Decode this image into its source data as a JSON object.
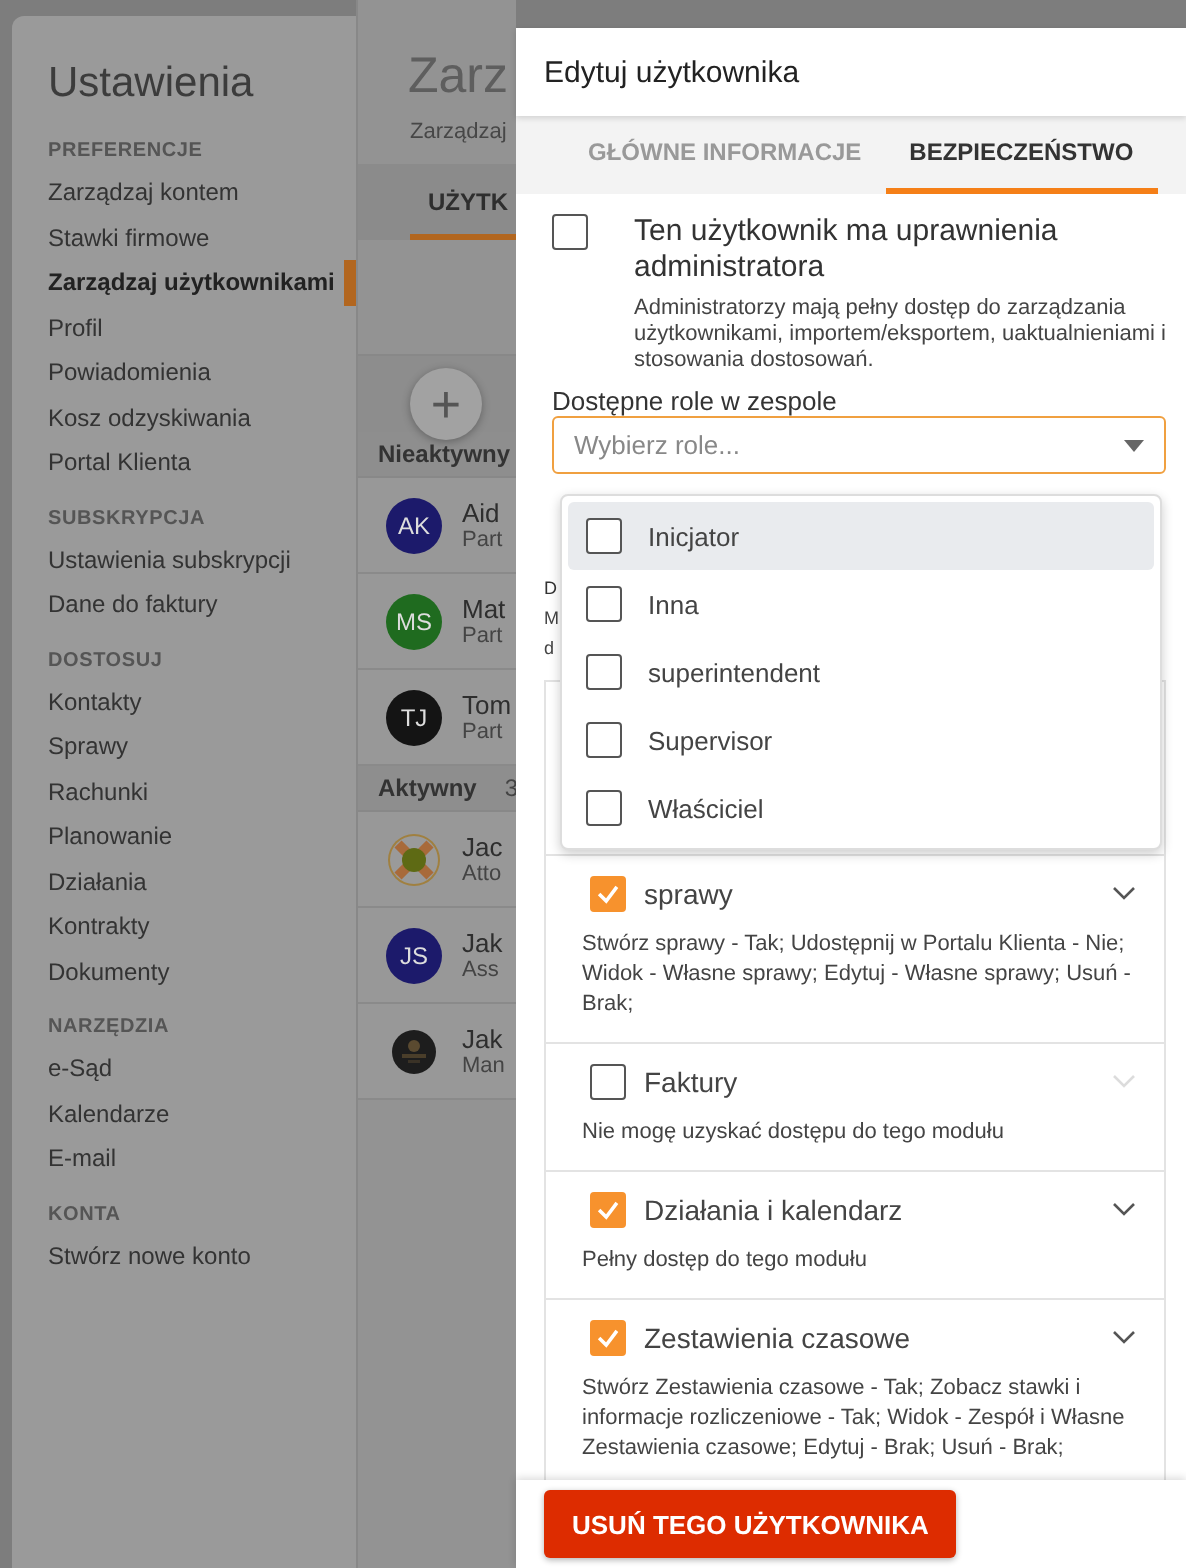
{
  "sidebar": {
    "title": "Ustawienia",
    "sections": [
      {
        "heading": "PREFERENCJE",
        "items": [
          {
            "label": "Zarządzaj kontem",
            "selected": false
          },
          {
            "label": "Stawki firmowe",
            "selected": false
          },
          {
            "label": "Zarządzaj użytkownikami",
            "selected": true
          },
          {
            "label": "Profil",
            "selected": false
          },
          {
            "label": "Powiadomienia",
            "selected": false
          },
          {
            "label": "Kosz odzyskiwania",
            "selected": false
          },
          {
            "label": "Portal Klienta",
            "selected": false
          }
        ]
      },
      {
        "heading": "SUBSKRYPCJA",
        "items": [
          {
            "label": "Ustawienia subskrypcji",
            "selected": false
          },
          {
            "label": "Dane do faktury",
            "selected": false
          }
        ]
      },
      {
        "heading": "DOSTOSUJ",
        "items": [
          {
            "label": "Kontakty",
            "selected": false
          },
          {
            "label": "Sprawy",
            "selected": false
          },
          {
            "label": "Rachunki",
            "selected": false
          },
          {
            "label": "Planowanie",
            "selected": false
          },
          {
            "label": "Działania",
            "selected": false
          },
          {
            "label": "Kontrakty",
            "selected": false
          },
          {
            "label": "Dokumenty",
            "selected": false
          }
        ]
      },
      {
        "heading": "NARZĘDZIA",
        "items": [
          {
            "label": "e-Sąd",
            "selected": false
          },
          {
            "label": "Kalendarze",
            "selected": false
          },
          {
            "label": "E-mail",
            "selected": false
          }
        ]
      },
      {
        "heading": "KONTA",
        "items": [
          {
            "label": "Stwórz nowe konto",
            "selected": false
          }
        ]
      }
    ]
  },
  "main": {
    "title": "Zarz",
    "subtitle": "Zarządzaj",
    "tabs": [
      {
        "label": "UŻYTK",
        "selected": true
      }
    ],
    "add_button": "+",
    "groups": [
      {
        "label": "Nieaktywny",
        "users": [
          {
            "name": "Aid",
            "role": "Part",
            "avatar": {
              "kind": "initials",
              "initials": "AK",
              "color": "#1c1a6b"
            }
          },
          {
            "name": "Mat",
            "role": "Part",
            "avatar": {
              "kind": "initials",
              "initials": "MS",
              "color": "#1f6b1f"
            }
          },
          {
            "name": "Tom",
            "role": "Part",
            "avatar": {
              "kind": "initials",
              "initials": "TJ",
              "color": "#141414"
            }
          }
        ]
      },
      {
        "label": "Aktywny",
        "count": "3",
        "users": [
          {
            "name": "Jac",
            "role": "Atto",
            "avatar": {
              "kind": "lifebuoy"
            }
          },
          {
            "name": "Jak",
            "role": "Ass",
            "avatar": {
              "kind": "initials",
              "initials": "JS",
              "color": "#1c1a6b"
            }
          },
          {
            "name": "Jak",
            "role": "Man"
          }
        ]
      }
    ]
  },
  "dialog": {
    "title": "Edytuj użytkownika",
    "tabs": [
      {
        "label": "GŁÓWNE INFORMACJE",
        "selected": false
      },
      {
        "label": "BEZPIECZEŃSTWO",
        "selected": true
      }
    ],
    "admin": {
      "checked": false,
      "label": "Ten użytkownik ma uprawnienia administratora",
      "description": "Administratorzy mają pełny dostęp do zarządzania użytkownikami, importem/eksportem, uaktualnieniami i stosowania dostosowań."
    },
    "roles": {
      "label": "Dostępne role w zespole",
      "placeholder": "Wybierz role...",
      "expanded": true,
      "options": [
        {
          "label": "Inicjator",
          "checked": false,
          "highlighted": true
        },
        {
          "label": "Inna",
          "checked": false,
          "highlighted": false
        },
        {
          "label": "superintendent",
          "checked": false,
          "highlighted": false
        },
        {
          "label": "Supervisor",
          "checked": false,
          "highlighted": false
        },
        {
          "label": "Właściciel",
          "checked": false,
          "highlighted": false
        }
      ]
    },
    "covered_section": {
      "title": "D",
      "lines": [
        "M",
        "d"
      ]
    },
    "modules": [
      {
        "name": "sprawy",
        "checked": true,
        "description": "Stwórz sprawy - Tak; Udostępnij w Portalu Klienta - Nie; Widok - Własne sprawy; Edytuj - Własne sprawy; Usuń - Brak;"
      },
      {
        "name": "Faktury",
        "checked": false,
        "description": "Nie mogę uzyskać dostępu do tego modułu"
      },
      {
        "name": "Działania i kalendarz",
        "checked": true,
        "description": "Pełny dostęp do tego modułu"
      },
      {
        "name": "Zestawienia czasowe",
        "checked": true,
        "description": "Stwórz Zestawienia czasowe - Tak; Zobacz stawki i informacje rozliczeniowe - Tak; Widok - Zespół i Własne Zestawienia czasowe; Edytuj - Brak; Usuń - Brak;"
      }
    ],
    "delete_button": "USUŃ TEGO UŻYTKOWNIKA"
  }
}
